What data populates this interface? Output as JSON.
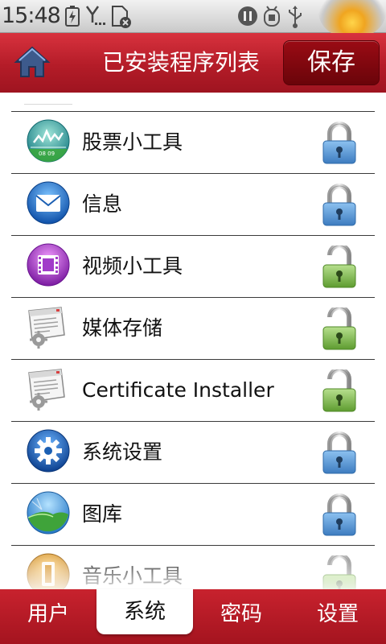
{
  "status_bar": {
    "time": "15:48",
    "icons": [
      "battery-charging-icon",
      "signal-icon",
      "sim-error-icon",
      "voicemail-icon",
      "usb-debug-icon",
      "usb-icon"
    ]
  },
  "header": {
    "home_icon": "home-icon",
    "title": "已安装程序列表",
    "save_label": "保存"
  },
  "apps": [
    {
      "label": "股票小工具",
      "icon": "stocks-widget-icon",
      "locked": true
    },
    {
      "label": "信息",
      "icon": "messaging-icon",
      "locked": true
    },
    {
      "label": "视频小工具",
      "icon": "video-widget-icon",
      "locked": false
    },
    {
      "label": "媒体存储",
      "icon": "default-app-icon",
      "locked": false
    },
    {
      "label": "Certificate Installer",
      "icon": "default-app-icon",
      "locked": false
    },
    {
      "label": "系统设置",
      "icon": "settings-icon",
      "locked": true
    },
    {
      "label": "图库",
      "icon": "gallery-icon",
      "locked": true
    },
    {
      "label": "音乐小工具",
      "icon": "music-widget-icon",
      "locked": false
    }
  ],
  "tabs": [
    {
      "label": "用户",
      "active": false
    },
    {
      "label": "系统",
      "active": true
    },
    {
      "label": "密码",
      "active": false
    },
    {
      "label": "设置",
      "active": false
    }
  ],
  "colors": {
    "brand_red": "#b41c28",
    "lock_locked": "#4f8fd0",
    "lock_unlocked": "#79b34a"
  }
}
